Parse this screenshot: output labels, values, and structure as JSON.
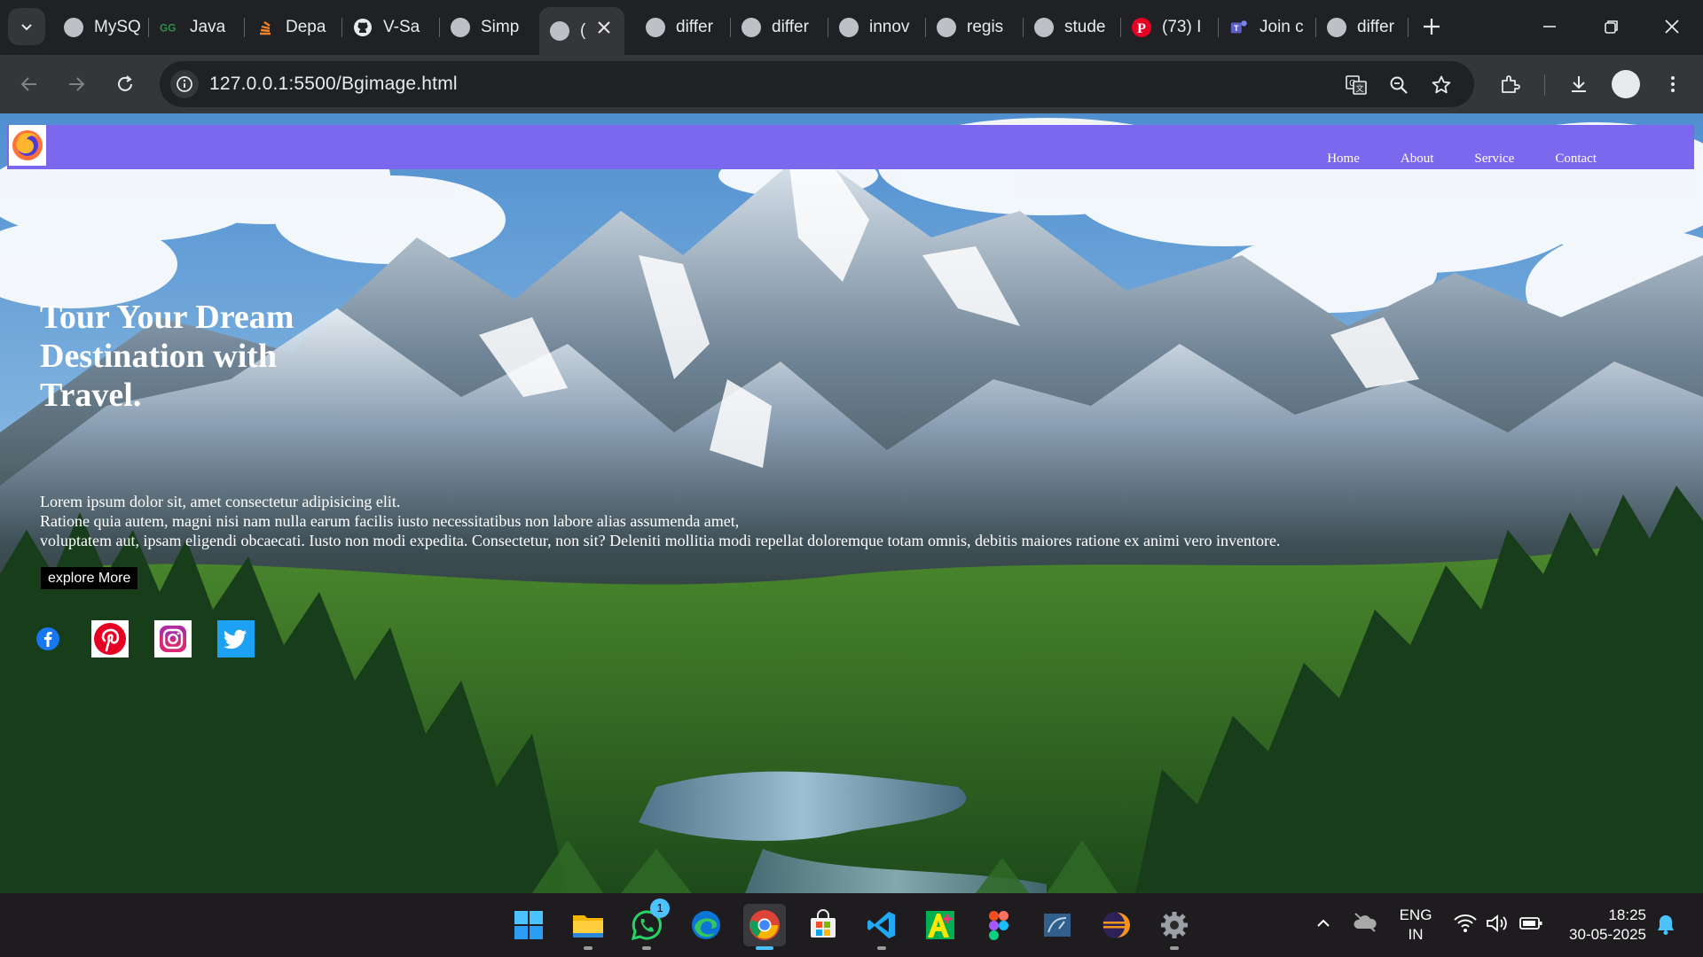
{
  "browser": {
    "tabs": [
      {
        "label": "MySQ",
        "icon": "globe-icon"
      },
      {
        "label": "Java",
        "icon": "gfg-icon"
      },
      {
        "label": "Depa",
        "icon": "stack-icon"
      },
      {
        "label": "V-Sa",
        "icon": "github-icon"
      },
      {
        "label": "Simp",
        "icon": "globe-icon"
      },
      {
        "label": "(",
        "icon": "globe-icon",
        "active": true
      },
      {
        "label": "differ",
        "icon": "globe-icon"
      },
      {
        "label": "differ",
        "icon": "globe-icon"
      },
      {
        "label": "innov",
        "icon": "globe-icon"
      },
      {
        "label": "regis",
        "icon": "globe-icon"
      },
      {
        "label": "stude",
        "icon": "globe-icon"
      },
      {
        "label": "(73) I",
        "icon": "pinterest-icon"
      },
      {
        "label": "Join c",
        "icon": "teams-icon"
      },
      {
        "label": "differ",
        "icon": "globe-icon"
      }
    ],
    "url": "127.0.0.1:5500/Bgimage.html"
  },
  "page": {
    "nav": [
      "Home",
      "About",
      "Service",
      "Contact"
    ],
    "hero_title": "Tour Your Dream Destination with Travel.",
    "hero_lines": [
      "Lorem ipsum dolor sit, amet consectetur adipisicing elit.",
      "Ratione quia autem, magni nisi nam nulla earum facilis iusto necessitatibus non labore alias assumenda amet,",
      "voluptatem aut, ipsam eligendi obcaecati. Iusto non modi expedita. Consectetur, non sit? Deleniti mollitia modi repellat doloremque totam omnis, debitis maiores ratione ex animi vero inventore."
    ],
    "button": "explore More",
    "social": [
      "facebook-icon",
      "pinterest-icon",
      "instagram-icon",
      "twitter-icon"
    ]
  },
  "taskbar": {
    "whatsapp_badge": "1",
    "lang_top": "ENG",
    "lang_bottom": "IN",
    "time": "18:25",
    "date": "30-05-2025"
  },
  "colors": {
    "nav_bg": "#7b68ee",
    "chrome_dark": "#202124",
    "chrome_toolbar": "#35363a",
    "taskbar_bg": "#1f1c20"
  }
}
